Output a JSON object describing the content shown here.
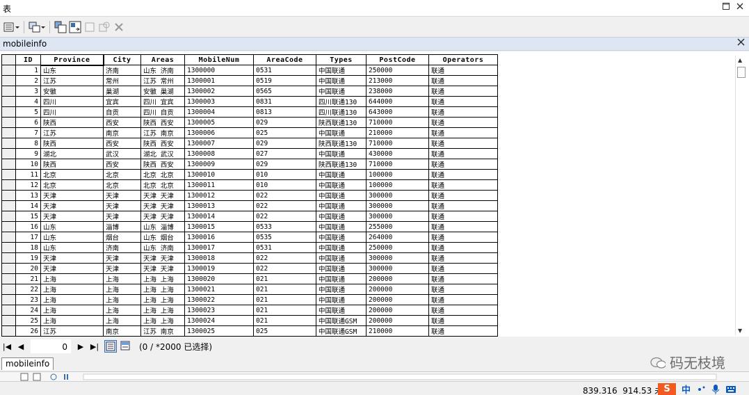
{
  "window": {
    "title": "表"
  },
  "panel": {
    "title": "mobileinfo"
  },
  "columns": [
    "ID",
    "Province",
    "City",
    "Areas",
    "MobileNum",
    "AreaCode",
    "Types",
    "PostCode",
    "Operators"
  ],
  "rows": [
    [
      "1",
      "山东",
      "济南",
      "山东 济南",
      "1300000",
      "0531",
      "中国联通",
      "250000",
      "联通"
    ],
    [
      "2",
      "江苏",
      "常州",
      "江苏 常州",
      "1300001",
      "0519",
      "中国联通",
      "213000",
      "联通"
    ],
    [
      "3",
      "安徽",
      "巢湖",
      "安徽 巢湖",
      "1300002",
      "0565",
      "中国联通",
      "238000",
      "联通"
    ],
    [
      "4",
      "四川",
      "宜宾",
      "四川 宜宾",
      "1300003",
      "0831",
      "四川联通130",
      "644000",
      "联通"
    ],
    [
      "5",
      "四川",
      "自贡",
      "四川 自贡",
      "1300004",
      "0813",
      "四川联通130",
      "643000",
      "联通"
    ],
    [
      "6",
      "陕西",
      "西安",
      "陕西 西安",
      "1300005",
      "029",
      "陕西联通130",
      "710000",
      "联通"
    ],
    [
      "7",
      "江苏",
      "南京",
      "江苏 南京",
      "1300006",
      "025",
      "中国联通",
      "210000",
      "联通"
    ],
    [
      "8",
      "陕西",
      "西安",
      "陕西 西安",
      "1300007",
      "029",
      "陕西联通130",
      "710000",
      "联通"
    ],
    [
      "9",
      "湖北",
      "武汉",
      "湖北 武汉",
      "1300008",
      "027",
      "中国联通",
      "430000",
      "联通"
    ],
    [
      "10",
      "陕西",
      "西安",
      "陕西 西安",
      "1300009",
      "029",
      "陕西联通130",
      "710000",
      "联通"
    ],
    [
      "11",
      "北京",
      "北京",
      "北京 北京",
      "1300010",
      "010",
      "中国联通",
      "100000",
      "联通"
    ],
    [
      "12",
      "北京",
      "北京",
      "北京 北京",
      "1300011",
      "010",
      "中国联通",
      "100000",
      "联通"
    ],
    [
      "13",
      "天津",
      "天津",
      "天津 天津",
      "1300012",
      "022",
      "中国联通",
      "300000",
      "联通"
    ],
    [
      "14",
      "天津",
      "天津",
      "天津 天津",
      "1300013",
      "022",
      "中国联通",
      "300000",
      "联通"
    ],
    [
      "15",
      "天津",
      "天津",
      "天津 天津",
      "1300014",
      "022",
      "中国联通",
      "300000",
      "联通"
    ],
    [
      "16",
      "山东",
      "淄博",
      "山东 淄博",
      "1300015",
      "0533",
      "中国联通",
      "255000",
      "联通"
    ],
    [
      "17",
      "山东",
      "烟台",
      "山东 烟台",
      "1300016",
      "0535",
      "中国联通",
      "264000",
      "联通"
    ],
    [
      "18",
      "山东",
      "济南",
      "山东 济南",
      "1300017",
      "0531",
      "中国联通",
      "250000",
      "联通"
    ],
    [
      "19",
      "天津",
      "天津",
      "天津 天津",
      "1300018",
      "022",
      "中国联通",
      "300000",
      "联通"
    ],
    [
      "20",
      "天津",
      "天津",
      "天津 天津",
      "1300019",
      "022",
      "中国联通",
      "300000",
      "联通"
    ],
    [
      "21",
      "上海",
      "上海",
      "上海 上海",
      "1300020",
      "021",
      "中国联通",
      "200000",
      "联通"
    ],
    [
      "22",
      "上海",
      "上海",
      "上海 上海",
      "1300021",
      "021",
      "中国联通",
      "200000",
      "联通"
    ],
    [
      "23",
      "上海",
      "上海",
      "上海 上海",
      "1300022",
      "021",
      "中国联通",
      "200000",
      "联通"
    ],
    [
      "24",
      "上海",
      "上海",
      "上海 上海",
      "1300023",
      "021",
      "中国联通",
      "200000",
      "联通"
    ],
    [
      "25",
      "上海",
      "上海",
      "上海 上海",
      "1300024",
      "021",
      "中国联通GSM",
      "200000",
      "联通"
    ],
    [
      "26",
      "江苏",
      "南京",
      "江苏 南京",
      "1300025",
      "025",
      "中国联通GSM",
      "210000",
      "联通"
    ]
  ],
  "nav": {
    "current": "0",
    "selection_text": "(0 / *2000 已选择)"
  },
  "tab": {
    "label": "mobileinfo"
  },
  "watermark": {
    "text": "码无枝境"
  },
  "status": {
    "x": "839.316",
    "y": "914.53",
    "unit": "未"
  },
  "ime": {
    "logo": "S",
    "lang": "中"
  }
}
